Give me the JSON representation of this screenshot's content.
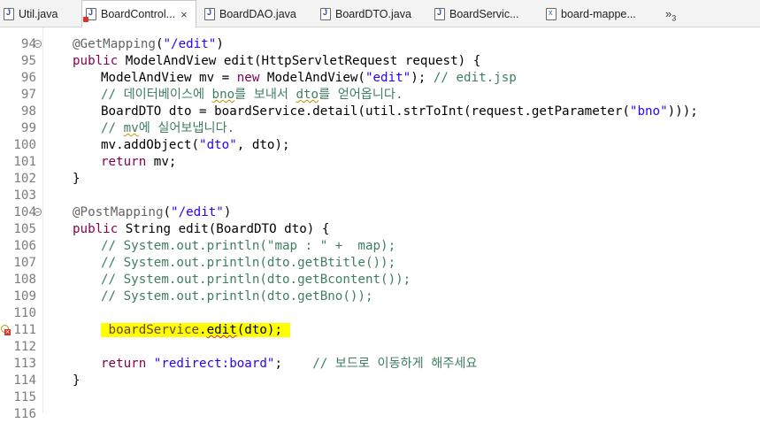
{
  "tabs": [
    {
      "label": "Util.java",
      "icon": "java-file-icon"
    },
    {
      "label": "BoardControl...",
      "icon": "java-file-error-icon",
      "active": true,
      "close": "×"
    },
    {
      "label": "BoardDAO.java",
      "icon": "java-file-icon"
    },
    {
      "label": "BoardDTO.java",
      "icon": "java-file-icon"
    },
    {
      "label": "BoardServic...",
      "icon": "java-file-icon"
    },
    {
      "label": "board-mappe...",
      "icon": "xml-file-icon"
    }
  ],
  "overflow": {
    "symbol": "»",
    "count": "3"
  },
  "lines": [
    {
      "n": "94",
      "t": "@GetMapping(\"/edit\")"
    },
    {
      "n": "95",
      "t": "public ModelAndView edit(HttpServletRequest request) {"
    },
    {
      "n": "96",
      "t": "ModelAndView mv = new ModelAndView(\"edit\"); // edit.jsp"
    },
    {
      "n": "97",
      "t": "// 데이터베이스에 bno를 보내서 dto를 얻어옵니다."
    },
    {
      "n": "98",
      "t": "BoardDTO dto = boardService.detail(util.strToInt(request.getParameter(\"bno\")));"
    },
    {
      "n": "99",
      "t": "// mv에 실어보냅니다."
    },
    {
      "n": "100",
      "t": "mv.addObject(\"dto\", dto);"
    },
    {
      "n": "101",
      "t": "return mv;"
    },
    {
      "n": "102",
      "t": "}"
    },
    {
      "n": "103",
      "t": ""
    },
    {
      "n": "104",
      "t": "@PostMapping(\"/edit\")"
    },
    {
      "n": "105",
      "t": "public String edit(BoardDTO dto) {"
    },
    {
      "n": "106",
      "t": "// System.out.println(\"map : \" +  map);"
    },
    {
      "n": "107",
      "t": "// System.out.println(dto.getBtitle());"
    },
    {
      "n": "108",
      "t": "// System.out.println(dto.getBcontent());"
    },
    {
      "n": "109",
      "t": "// System.out.println(dto.getBno());"
    },
    {
      "n": "110",
      "t": ""
    },
    {
      "n": "111",
      "t": "boardService.edit(dto);",
      "error": true
    },
    {
      "n": "112",
      "t": ""
    },
    {
      "n": "113",
      "t": "return \"redirect:board\";    // 보드로 이동하게 해주세요"
    },
    {
      "n": "114",
      "t": "}"
    },
    {
      "n": "115",
      "t": ""
    },
    {
      "n": "116",
      "t": ""
    }
  ],
  "colors": {
    "keyword": "#7f0055",
    "annotation": "#646464",
    "string": "#2a00ff",
    "comment": "#3f7f5f",
    "highlight": "#ffff00",
    "error": "#d9342b"
  }
}
